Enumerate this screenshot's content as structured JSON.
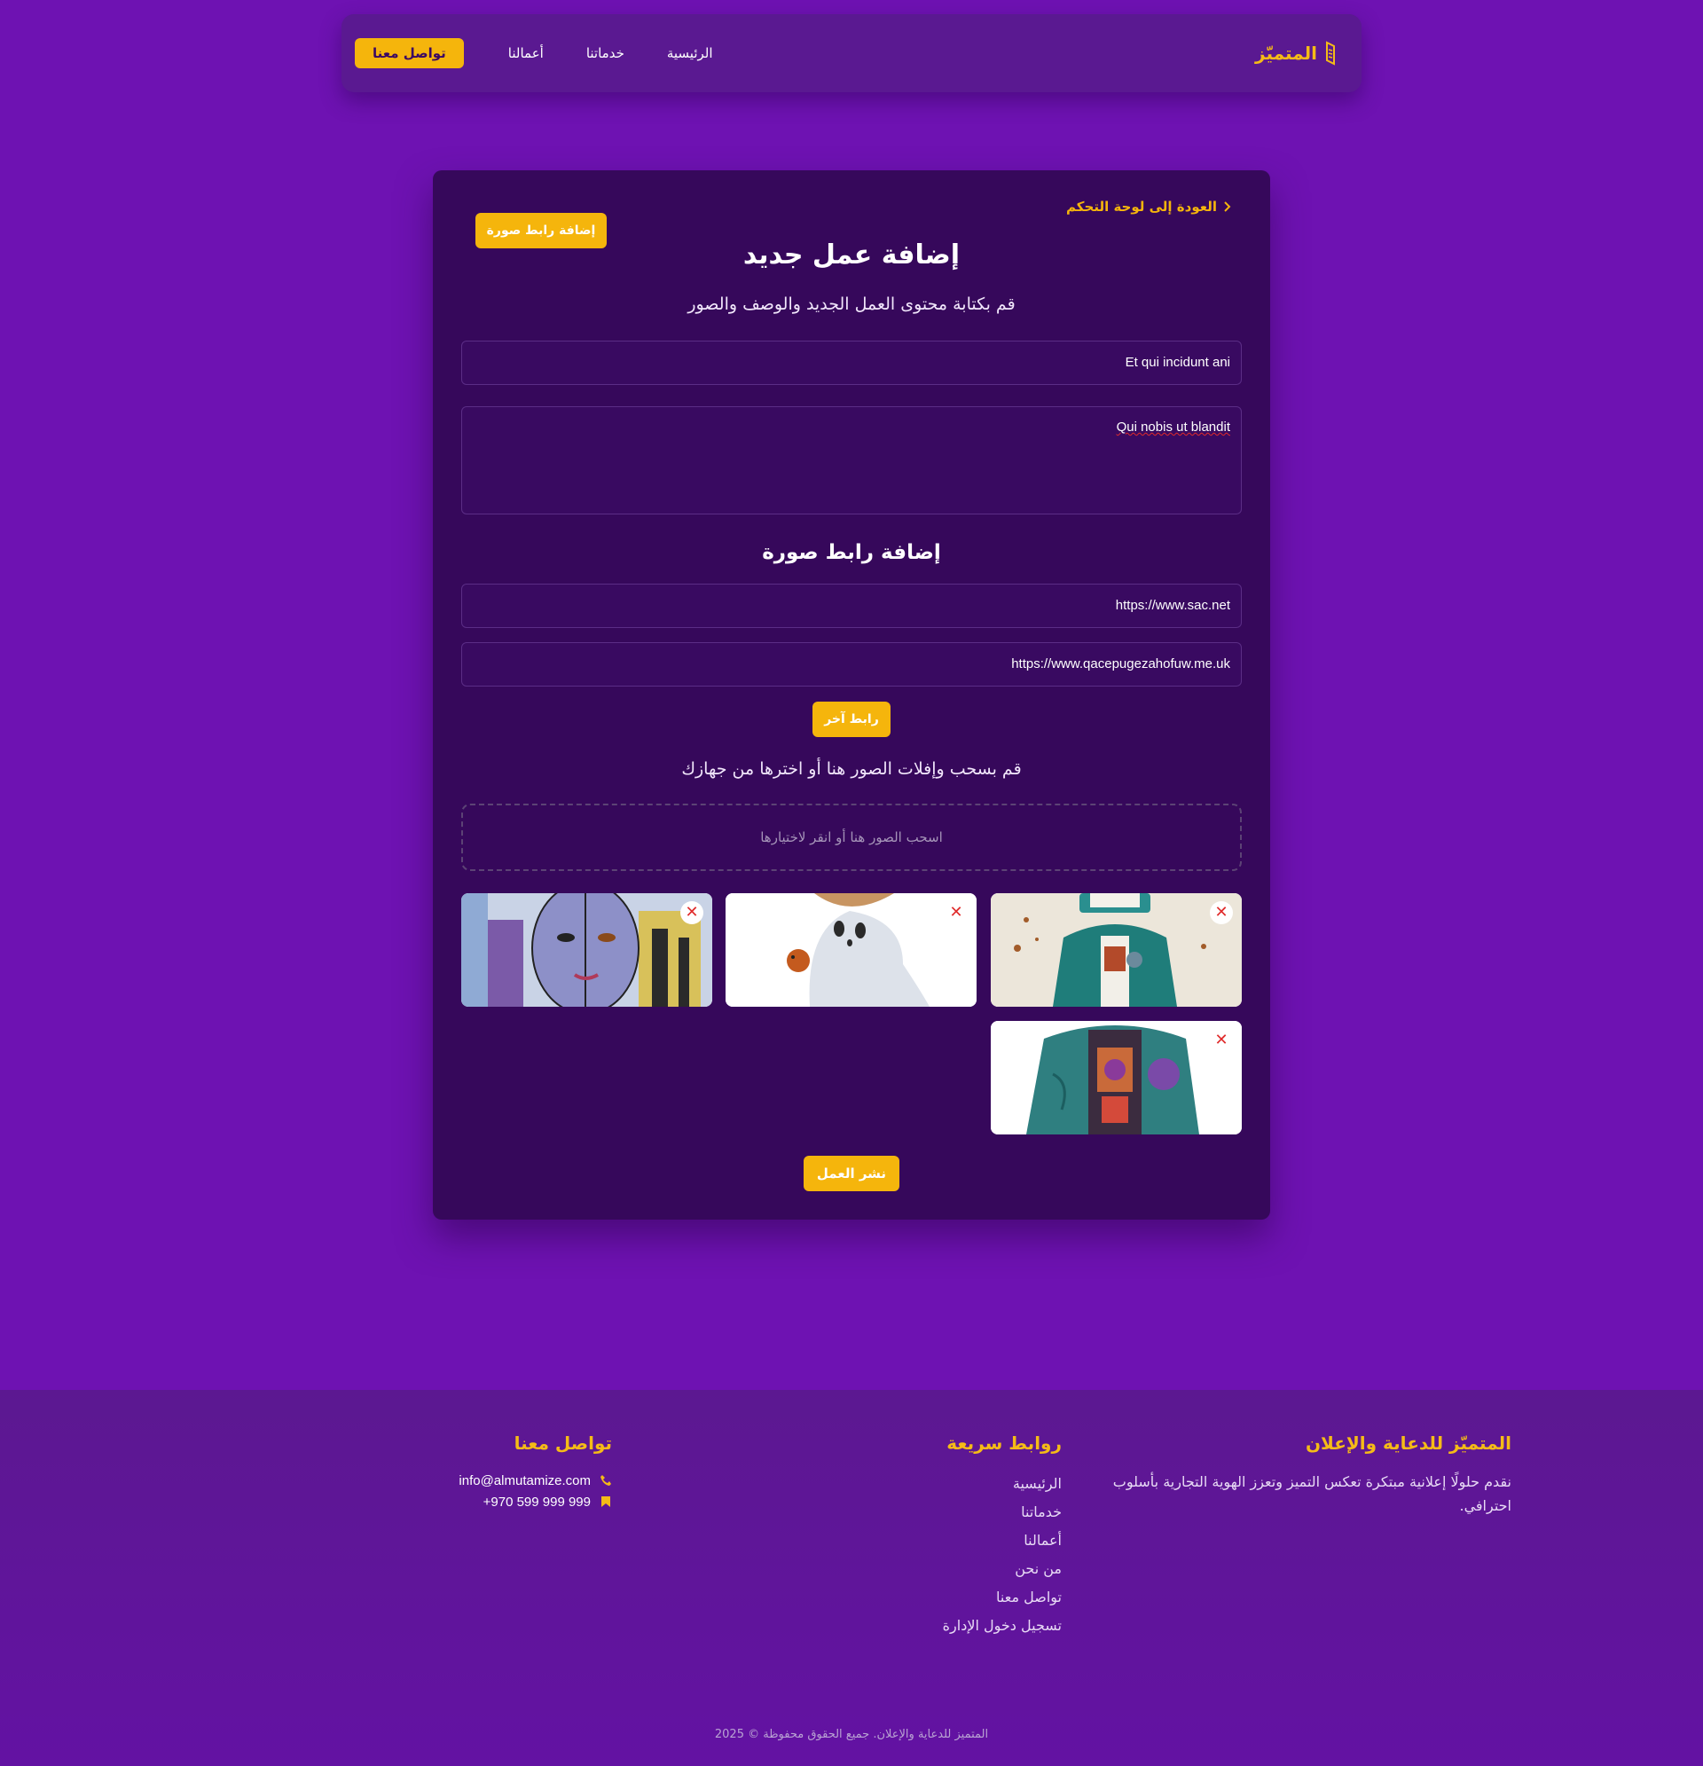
{
  "header": {
    "brand": "المتميّز",
    "nav": [
      "الرئيسية",
      "خدماتنا",
      "أعمالنا"
    ],
    "cta": "تواصل معنا"
  },
  "form": {
    "back_link": "العودة إلى لوحة التحكم",
    "add_url_top": "إضافة رابط صورة",
    "title": "إضافة عمل جديد",
    "subtitle": "قم بكتابة محتوى العمل الجديد والوصف والصور",
    "title_value": "Et qui incidunt ani",
    "description_value": "Qui nobis ut blandit",
    "url_section_title": "إضافة رابط صورة",
    "urls": [
      "https://www.sac.net",
      "https://www.qacepugezahofuw.me.uk"
    ],
    "another_link": "رابط آخر",
    "drop_hint": "قم بسحب وإفلات الصور هنا أو اخترها من جهازك",
    "dropzone_text": "اسحب الصور هنا أو انقر لاختيارها",
    "images": [
      {
        "subject": "robot-in-jacket"
      },
      {
        "subject": "ghost-with-bird"
      },
      {
        "subject": "face-with-city"
      },
      {
        "subject": "jacket-art"
      }
    ],
    "remove_symbol": "✕",
    "publish": "نشر العمل"
  },
  "footer": {
    "about_title": "المتميّز للدعاية والإعلان",
    "about_text": "نقدم حلولًا إعلانية مبتكرة تعكس التميز وتعزز الهوية التجارية بأسلوب احترافي.",
    "links_title": "روابط سريعة",
    "links": [
      "الرئيسية",
      "خدماتنا",
      "أعمالنا",
      "من نحن",
      "تواصل معنا",
      "تسجيل دخول الإدارة"
    ],
    "contact_title": "تواصل معنا",
    "email": "info@almutamize.com",
    "phone": "+970 599 999 999",
    "copyright": "المتميز للدعاية والإعلان. جميع الحقوق محفوظة © 2025"
  },
  "colors": {
    "background": "#6e12b2",
    "card": "#36085b",
    "accent": "#f5b50c",
    "remove": "#e02b2b"
  },
  "icons": [
    "brand-logo-icon",
    "chevron-right-icon",
    "close-icon",
    "phone-icon",
    "envelope-icon"
  ]
}
